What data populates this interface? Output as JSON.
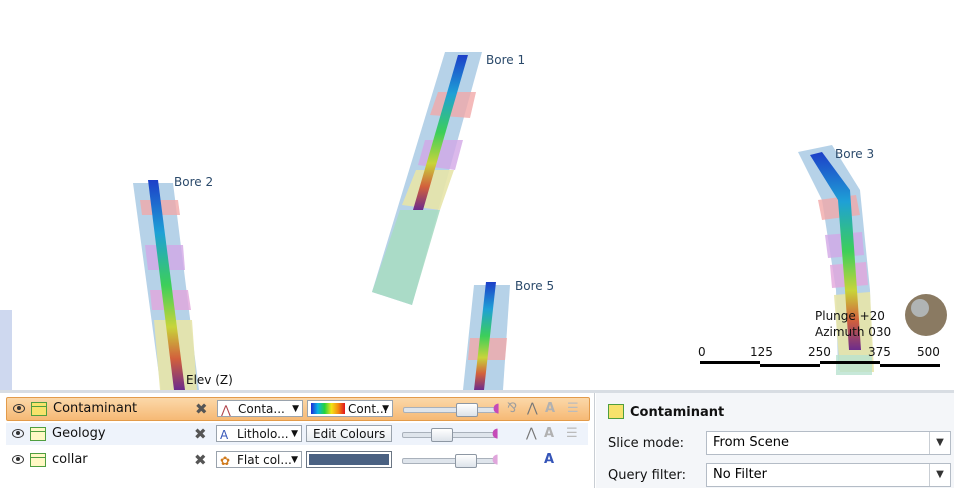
{
  "viewport": {
    "bores": [
      {
        "label": "Bore 1"
      },
      {
        "label": "Bore 2"
      },
      {
        "label": "Bore 3"
      },
      {
        "label": "Bore 5"
      }
    ],
    "axis_label": "Elev (Z)",
    "plunge": "Plunge +20",
    "azimuth": "Azimuth 030",
    "scale_ticks": [
      "0",
      "125",
      "250",
      "375",
      "500"
    ]
  },
  "layers": [
    {
      "name": "Contaminant",
      "selected": true,
      "dropdown1": "Conta...",
      "dropdown2": "Cont...",
      "slider_level": 0.72
    },
    {
      "name": "Geology",
      "selected": false,
      "dropdown1": "Litholo...",
      "button": "Edit Colours",
      "slider_level": 0.42,
      "color": "#4a6182"
    },
    {
      "name": "collar",
      "selected": false,
      "dropdown1": "Flat col...",
      "slider_level": 0.72,
      "color": "#4a6182"
    }
  ],
  "properties": {
    "title": "Contaminant",
    "slice_mode_label": "Slice mode:",
    "slice_mode_value": "From Scene",
    "query_filter_label": "Query filter:",
    "query_filter_value": "No Filter"
  }
}
